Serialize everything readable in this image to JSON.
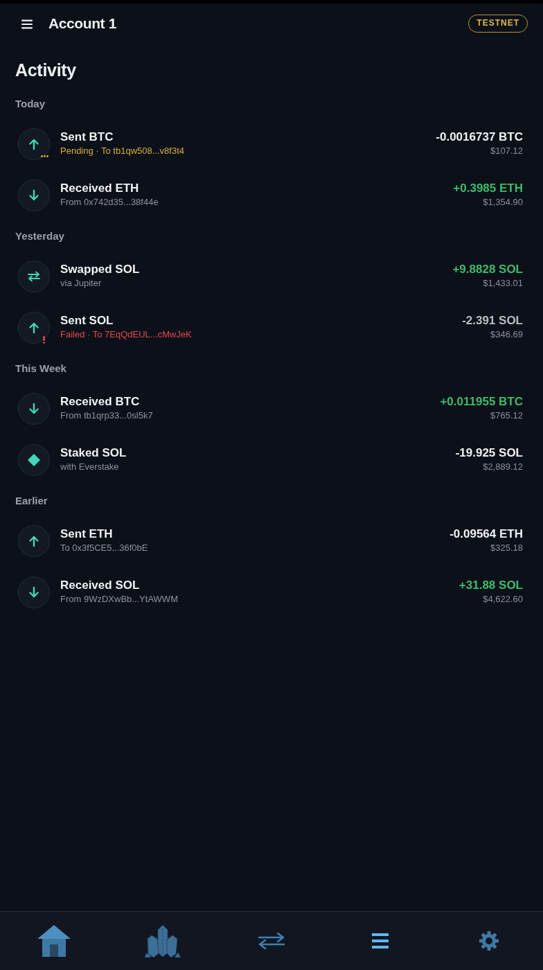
{
  "header": {
    "account": "Account 1",
    "network_badge": "TESTNET"
  },
  "title": "Activity",
  "sections": [
    {
      "label": "Today",
      "transactions": [
        {
          "kind": "send",
          "pending": true,
          "failed": false,
          "title": "Sent BTC",
          "subtitle": "Pending · To tb1qw508...v8f3t4",
          "amount": "-0.0016737 BTC",
          "credit": false,
          "fiat": "$107.12"
        },
        {
          "kind": "receive",
          "pending": false,
          "failed": false,
          "title": "Received ETH",
          "subtitle": "From 0x742d35...38f44e",
          "amount": "+0.3985 ETH",
          "credit": true,
          "fiat": "$1,354.90"
        }
      ]
    },
    {
      "label": "Yesterday",
      "transactions": [
        {
          "kind": "swap",
          "pending": false,
          "failed": false,
          "title": "Swapped SOL",
          "subtitle": "via Jupiter",
          "amount": "+9.8828 SOL",
          "credit": true,
          "fiat": "$1,433.01"
        },
        {
          "kind": "send",
          "pending": false,
          "failed": true,
          "title": "Sent SOL",
          "subtitle": "Failed · To 7EqQdEUL...cMwJeK",
          "amount": "-2.391 SOL",
          "credit": false,
          "fiat": "$346.69"
        }
      ]
    },
    {
      "label": "This Week",
      "transactions": [
        {
          "kind": "receive",
          "pending": false,
          "failed": false,
          "title": "Received BTC",
          "subtitle": "From tb1qrp33...0sl5k7",
          "amount": "+0.011955 BTC",
          "credit": true,
          "fiat": "$765.12"
        },
        {
          "kind": "stake",
          "pending": false,
          "failed": false,
          "title": "Staked SOL",
          "subtitle": "with Everstake",
          "amount": "-19.925 SOL",
          "credit": false,
          "fiat": "$2,889.12"
        }
      ]
    },
    {
      "label": "Earlier",
      "transactions": [
        {
          "kind": "send",
          "pending": false,
          "failed": false,
          "title": "Sent ETH",
          "subtitle": "To 0x3f5CE5...36f0bE",
          "amount": "-0.09564 ETH",
          "credit": false,
          "fiat": "$325.18"
        },
        {
          "kind": "receive",
          "pending": false,
          "failed": false,
          "title": "Received SOL",
          "subtitle": "From 9WzDXwBb...YtAWWM",
          "amount": "+31.88 SOL",
          "credit": true,
          "fiat": "$4,622.60"
        }
      ]
    }
  ],
  "nav": [
    {
      "kind": "home",
      "selected": false
    },
    {
      "kind": "crystals",
      "selected": false
    },
    {
      "kind": "swap",
      "selected": false
    },
    {
      "kind": "activity",
      "selected": true
    },
    {
      "kind": "settings",
      "selected": false
    }
  ]
}
